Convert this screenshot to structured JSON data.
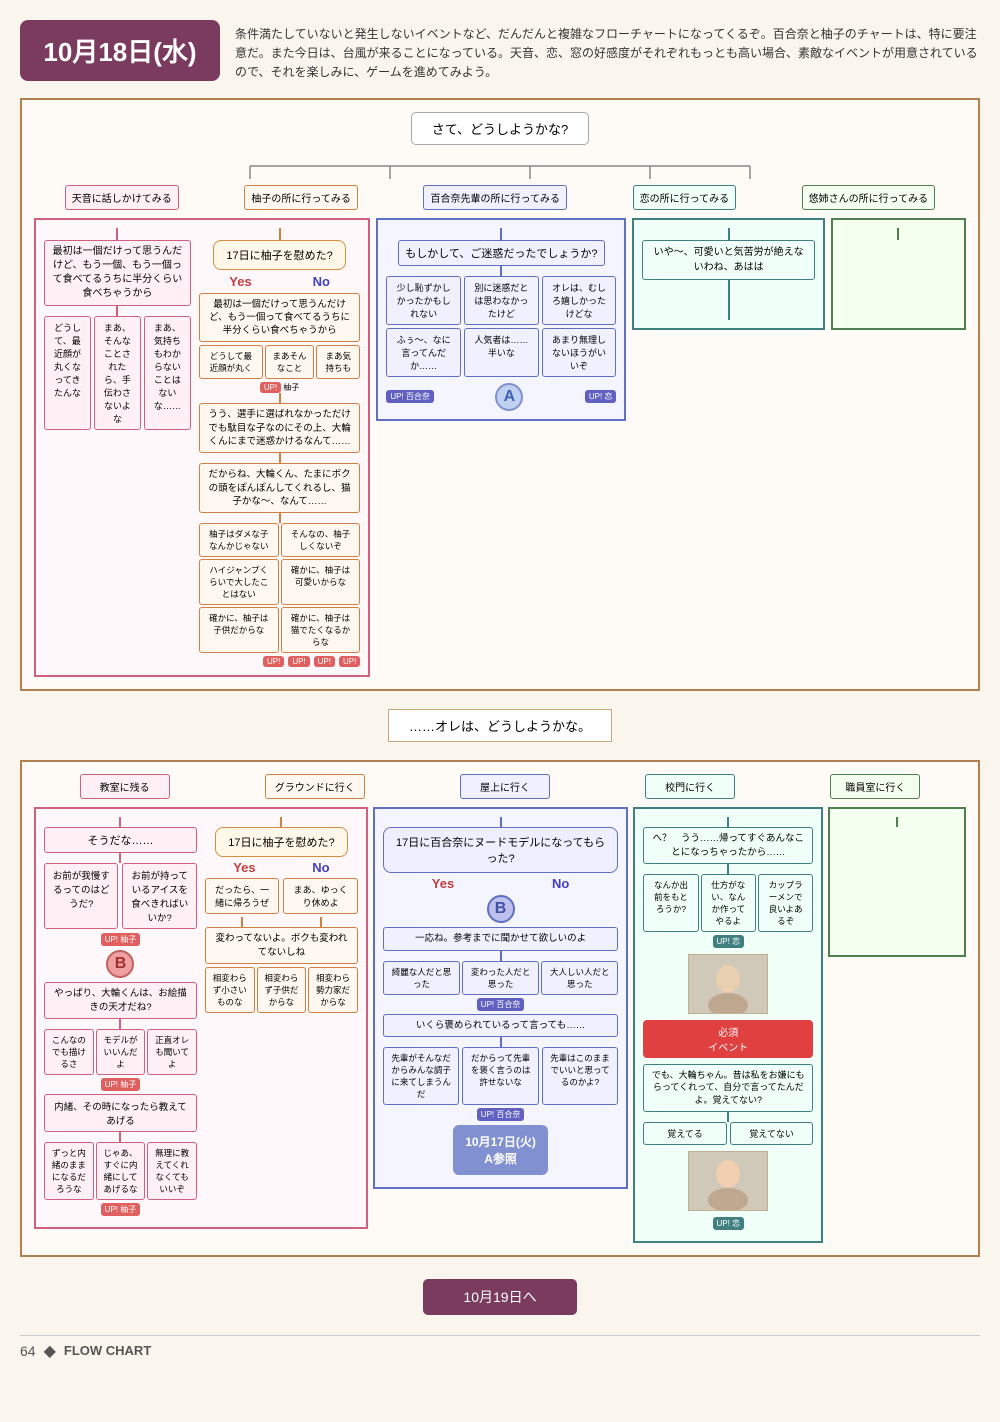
{
  "page": {
    "number": "64",
    "footer_title": "FLOW CHART"
  },
  "header": {
    "date": "10月18日(水)",
    "description": "条件満たしていないと発生しないイベントなど、だんだんと複雑なフローチャートになってくるぞ。百合奈と柚子のチャートは、特に要注意だ。また今日は、台風が来ることになっている。天音、恋、窓の好感度がそれぞれもっとも高い場合、素敵なイベントが用意されているので、それを楽しみに、ゲームを進めてみよう。"
  },
  "flowchart_top": {
    "start_question": "さて、どうしようかな?",
    "routes": [
      "天音に話しかけてみる",
      "柚子の所に行ってみる",
      "百合奈先輩の所に行ってみる",
      "恋の所に行ってみる",
      "悠姉さんの所に行ってみる"
    ]
  },
  "pink_route": {
    "q1": "17日に柚子を慰めた?",
    "yes": "YES",
    "no": "No",
    "text1": "最初は一個だけって思うんだけど、もう一個、もう一個って食べてるうちに半分くらい食べちゃうから",
    "ans1": "どうして、最近顔が丸くなってきたんな",
    "ans2": "まあ、そんなことされた ら、手伝わさないよな",
    "ans3": "まあ、気持ちもわからないことはないな……",
    "flow_text1": "うう、選手に選ばれなかっただけでも駄目な子なのにその上、大輪くんにまで迷惑かけるなんて……",
    "flow_text2": "だからね、大輪くん、たまにボクの頭をぽんぽんしてくれるし、猫子かな〜、なんて……",
    "answers_bottom": [
      "柚子はダメな子なんかじゃない",
      "そんなの、柚子しくないぞ",
      "ハイジャンプくらいで大したことはないぞ",
      "確かに、柚子は可愛いからな",
      "確かに、柚子は子供だからな",
      "確かに、柚子は猫でたくなるからな"
    ],
    "up_labels": [
      "UP! 柚子",
      "UP! 柚子",
      "UP! 柚子",
      "UP! 柚子"
    ]
  },
  "blue_route": {
    "q1": "もしかして、ご迷惑だったでしょうか?",
    "answers": [
      "少し恥ずかしかったかもしれない",
      "別に迷惑だとは思わなかったけど",
      "オレは、むしろ嬉しかったけどな",
      "ふぅ〜、なに言ってんだか……",
      "人気者は……半いな",
      "あまり無理しないほうがいいぞ"
    ],
    "marker": "A",
    "up_labels": [
      "UP! 百合奈",
      "UP! 恋"
    ]
  },
  "teal_route": {
    "q1": "いや〜、可愛いと気苦労が絶えないわね、あはは"
  },
  "middle_question": "……オレは、どうしようかな。",
  "lower_routes": [
    "教室に残る",
    "グラウンドに行く",
    "屋上に行く",
    "校門に行く",
    "職員室に行く"
  ],
  "lower_pink": {
    "q1": "そうだな……",
    "q2": "17日に柚子を慰めた?",
    "yes": "YES",
    "no": "No",
    "text1": "お前が我慢するってのはどうだ?",
    "text2": "お前が持っているアイスを食べきればいいか?",
    "marker": "B",
    "flow_text": "やっぱり、大輪くんは、お絵描きの天才だね?",
    "answers": [
      "こんなのでも描けるさ",
      "モデルがいいんだよ",
      "正直オレも聞いてよ"
    ],
    "up": "UP! 柚子",
    "text3": "内緒、その時になったら教えてあげる",
    "answers2": [
      "ずっと内緒のままになるだろうな",
      "じゃあ、すぐに内緒にしてあげるな",
      "無理に教えてくれなくてもいいぞ"
    ],
    "up2": "UP! 柚子"
  },
  "lower_blue": {
    "q1": "17日に百合奈にヌードモデルになってもらった?",
    "yes": "YES",
    "no": "No",
    "marker": "B",
    "flow_text": "一応ね。参考までに聞かせて欲しいのよ",
    "answers": [
      "綺麗な人だと思った",
      "変わった人だと思った",
      "大人しい人だと思った"
    ],
    "up": "UP! 百合奈",
    "text2": "いくら褒められているって言っても……",
    "flow_text2": "先輩がそんなだからみんな調子に来てしまうんだ",
    "answers2": [
      "だからって先輩を褒く言うのは許せないな",
      "先輩はこのままでいいと思ってるのかよ?"
    ],
    "up2": "UP! 百合奈",
    "date_special": "10月17日(火)\nA参照"
  },
  "lower_teal": {
    "text1": "へ？　うう……帰ってすぐあんなことになっちゃったから……",
    "answers": [
      "なんか出前をもとろうか?",
      "仕方がない、なんか作ってやるよ",
      "カップラーメンで良いよあるぞ"
    ],
    "up": "UP! 恋",
    "text2": "でも、大輪ちゃん。昔は私をお嫌にもらってくれって、自分で言ってたんだよ。覚えてない?",
    "answers2": [
      "覚えてる",
      "覚えてない"
    ],
    "required": "必須イベント"
  },
  "lower_green": {
    "text": "でも、大輪ちゃん。昔は私をお嫌にもらってくれって、自分で言ってたんだよ。覚えてない?"
  },
  "bottom": {
    "nav_label": "10月19日へ"
  }
}
